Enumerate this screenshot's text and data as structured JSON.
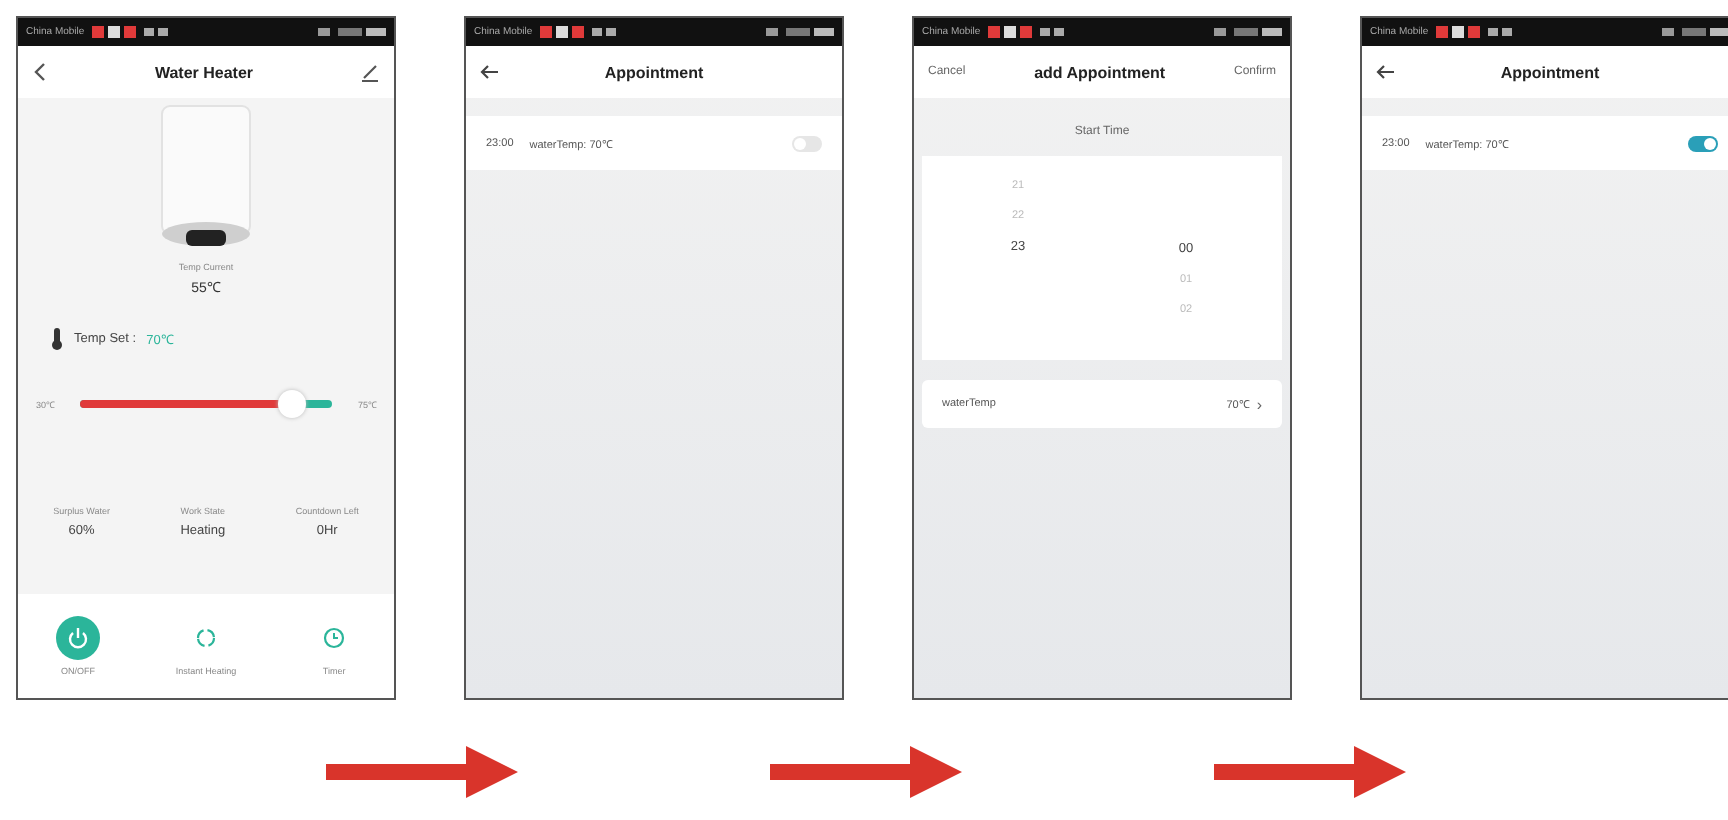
{
  "screens": [
    {
      "kind": "device",
      "carrier": "China Mobile",
      "title": "Water Heater",
      "temp_current_label": "Temp Current",
      "temp_current": "55℃",
      "temp_set_label": "Temp Set :",
      "temp_set": "70℃",
      "slider": {
        "min_label": "30℃",
        "max_label": "75℃",
        "level": 0.84
      },
      "stats": [
        {
          "label": "Surplus Water",
          "value": "60%"
        },
        {
          "label": "Work State",
          "value": "Heating"
        },
        {
          "label": "Countdown Left",
          "value": "0Hr"
        }
      ],
      "actions": [
        {
          "kind": "power",
          "label": "ON/OFF",
          "selected": true
        },
        {
          "kind": "instant",
          "label": "Instant Heating",
          "selected": false
        },
        {
          "kind": "timer",
          "label": "Timer",
          "selected": false
        }
      ]
    },
    {
      "kind": "list",
      "carrier": "China Mobile",
      "title": "Appointment",
      "items": [
        {
          "time": "23:00",
          "text": "waterTemp: 70℃",
          "on": false
        }
      ]
    },
    {
      "kind": "add",
      "carrier": "China Mobile",
      "cancel": "Cancel",
      "title": "add Appointment",
      "confirm": "Confirm",
      "section": "Start Time",
      "hours": [
        {
          "label": "21",
          "selected": false
        },
        {
          "label": "22",
          "selected": false
        },
        {
          "label": "23",
          "selected": true
        }
      ],
      "minutes": [
        {
          "label": "00",
          "selected": true
        },
        {
          "label": "01",
          "selected": false
        },
        {
          "label": "02",
          "selected": false
        }
      ],
      "field": {
        "label": "waterTemp",
        "value": "70℃",
        "chevron": "›"
      }
    },
    {
      "kind": "list",
      "carrier": "China Mobile",
      "title": "Appointment",
      "items": [
        {
          "time": "23:00",
          "text": "waterTemp: 70℃",
          "on": true
        }
      ]
    }
  ]
}
